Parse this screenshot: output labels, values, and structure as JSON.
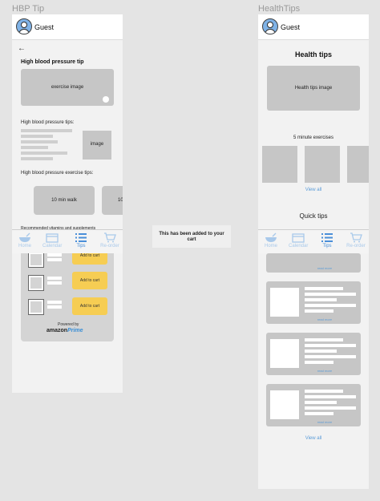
{
  "frames": [
    {
      "title": "HBP Tip",
      "header": {
        "user_name": "Guest"
      },
      "heading": "High blood pressure tip",
      "hero_image_label": "exercise image",
      "tips_heading": "High blood pressure tips:",
      "tips_image_label": "image",
      "exercise_heading": "High blood pressure exercise tips:",
      "exercise_pills": [
        "10 min walk",
        "10"
      ],
      "supplements_heading": "Recommended vitamins and supplements",
      "shop": {
        "cart_buttons": [
          "Add to cart",
          "Add to cart",
          "Add to cart"
        ],
        "powered_by": "Powered by",
        "amazon_word": "amazon",
        "prime_word": "Prime"
      }
    },
    {
      "title": "HealthTips",
      "header": {
        "user_name": "Guest"
      },
      "heading": "Health tips",
      "hero_image_label": "Health tips image",
      "exercises_heading": "5 minute exercises",
      "view_all_1": "View all",
      "quick_tips_heading": "Quick tips",
      "read_more": "read more",
      "view_all_2": "View all"
    }
  ],
  "navbar": {
    "items": [
      {
        "label": "Home",
        "icon": "bowl-icon"
      },
      {
        "label": "Calendar",
        "icon": "calendar-icon"
      },
      {
        "label": "Tips",
        "icon": "list-icon",
        "active": true
      },
      {
        "label": "Re-order",
        "icon": "cart-icon"
      }
    ]
  },
  "toast": {
    "line1": "This has been added to your",
    "line2": "cart"
  },
  "colors": {
    "accent": "#4a8fd9",
    "nav_inactive": "#a9c9ea",
    "cart_button": "#f6cd53",
    "card_gray": "#c6c6c6"
  }
}
